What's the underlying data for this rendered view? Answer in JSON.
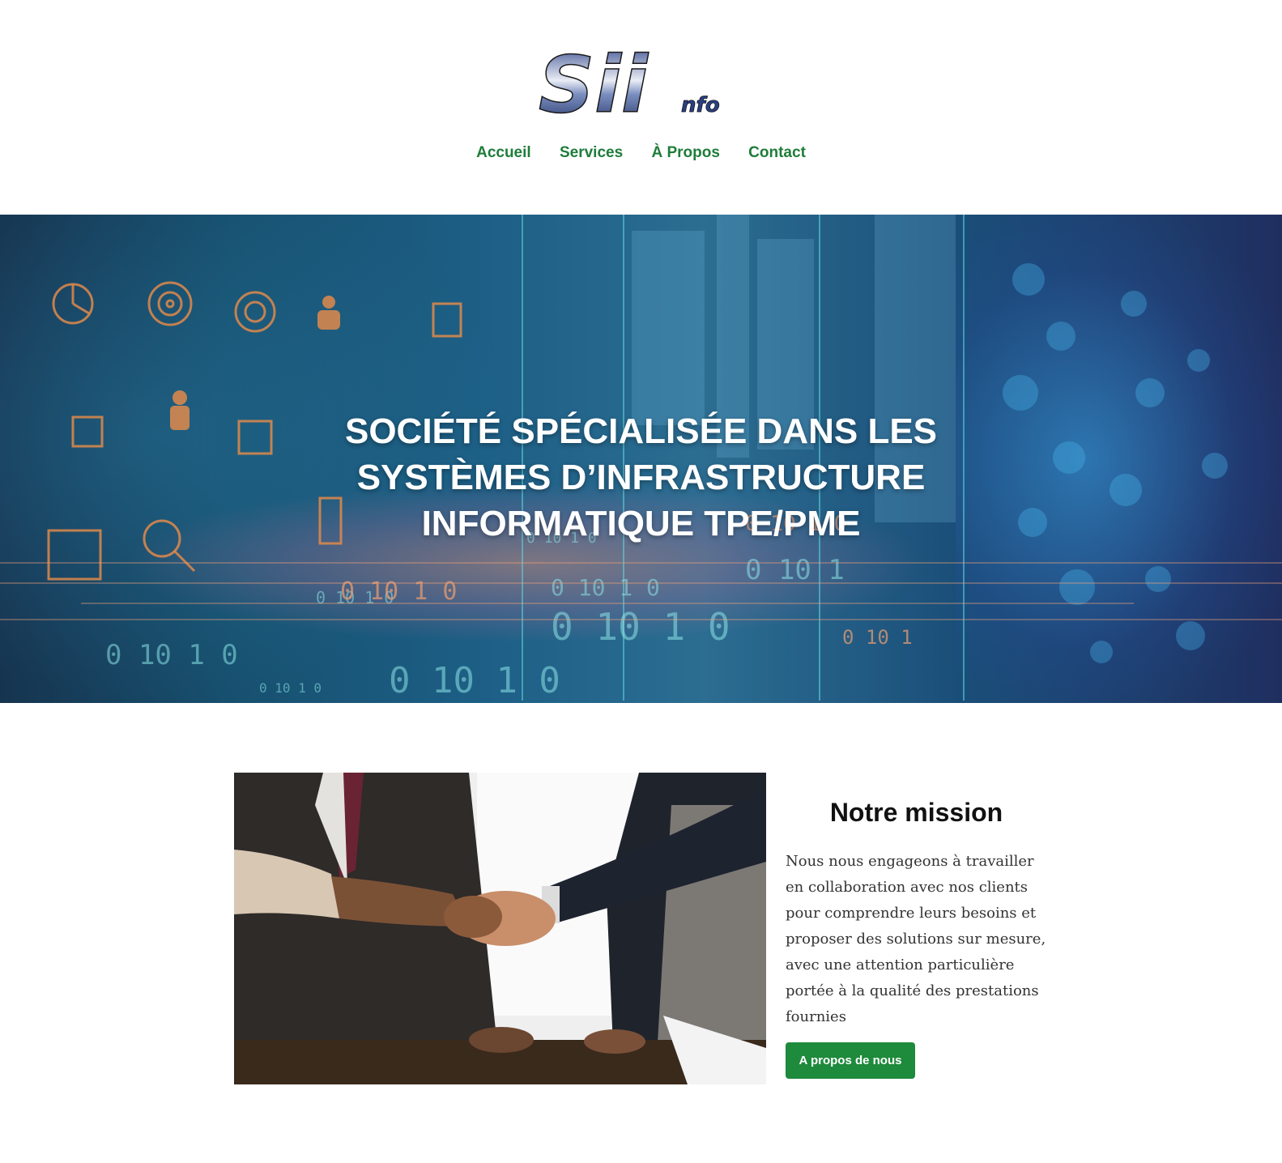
{
  "header": {
    "logo_text": "Sii",
    "logo_suffix": "nfo",
    "nav": [
      {
        "label": "Accueil"
      },
      {
        "label": "Services"
      },
      {
        "label": "À Propos"
      },
      {
        "label": "Contact"
      }
    ]
  },
  "hero": {
    "title": "SOCIÉTÉ SPÉCIALISÉE DANS LES SYSTÈMES D’INFRASTRUCTURE INFORMATIQUE TPE/PME"
  },
  "mission": {
    "title": "Notre mission",
    "text": "Nous nous engageons à travailler en collaboration avec nos clients pour comprendre leurs besoins et proposer des solutions sur mesure, avec une attention particulière portée à la qualité des prestations fournies",
    "button_label": "A propos de nous"
  },
  "colors": {
    "accent": "#1e7d3a",
    "button": "#1e8a3c"
  }
}
